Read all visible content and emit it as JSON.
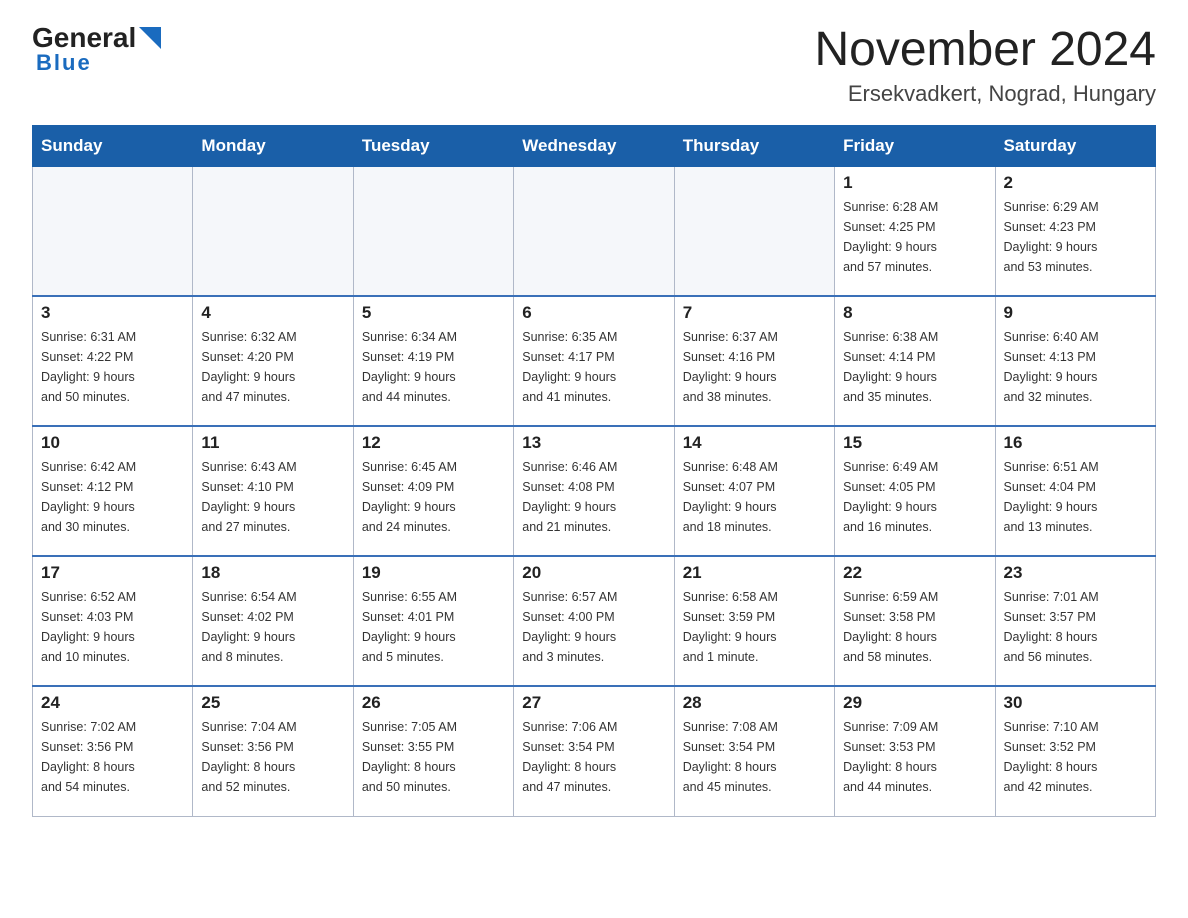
{
  "logo": {
    "name_black": "General",
    "name_blue": "Blue",
    "tagline": "Blue"
  },
  "header": {
    "title": "November 2024",
    "subtitle": "Ersekvadkert, Nograd, Hungary"
  },
  "days_of_week": [
    "Sunday",
    "Monday",
    "Tuesday",
    "Wednesday",
    "Thursday",
    "Friday",
    "Saturday"
  ],
  "weeks": [
    {
      "days": [
        {
          "num": "",
          "info": ""
        },
        {
          "num": "",
          "info": ""
        },
        {
          "num": "",
          "info": ""
        },
        {
          "num": "",
          "info": ""
        },
        {
          "num": "",
          "info": ""
        },
        {
          "num": "1",
          "info": "Sunrise: 6:28 AM\nSunset: 4:25 PM\nDaylight: 9 hours\nand 57 minutes."
        },
        {
          "num": "2",
          "info": "Sunrise: 6:29 AM\nSunset: 4:23 PM\nDaylight: 9 hours\nand 53 minutes."
        }
      ]
    },
    {
      "days": [
        {
          "num": "3",
          "info": "Sunrise: 6:31 AM\nSunset: 4:22 PM\nDaylight: 9 hours\nand 50 minutes."
        },
        {
          "num": "4",
          "info": "Sunrise: 6:32 AM\nSunset: 4:20 PM\nDaylight: 9 hours\nand 47 minutes."
        },
        {
          "num": "5",
          "info": "Sunrise: 6:34 AM\nSunset: 4:19 PM\nDaylight: 9 hours\nand 44 minutes."
        },
        {
          "num": "6",
          "info": "Sunrise: 6:35 AM\nSunset: 4:17 PM\nDaylight: 9 hours\nand 41 minutes."
        },
        {
          "num": "7",
          "info": "Sunrise: 6:37 AM\nSunset: 4:16 PM\nDaylight: 9 hours\nand 38 minutes."
        },
        {
          "num": "8",
          "info": "Sunrise: 6:38 AM\nSunset: 4:14 PM\nDaylight: 9 hours\nand 35 minutes."
        },
        {
          "num": "9",
          "info": "Sunrise: 6:40 AM\nSunset: 4:13 PM\nDaylight: 9 hours\nand 32 minutes."
        }
      ]
    },
    {
      "days": [
        {
          "num": "10",
          "info": "Sunrise: 6:42 AM\nSunset: 4:12 PM\nDaylight: 9 hours\nand 30 minutes."
        },
        {
          "num": "11",
          "info": "Sunrise: 6:43 AM\nSunset: 4:10 PM\nDaylight: 9 hours\nand 27 minutes."
        },
        {
          "num": "12",
          "info": "Sunrise: 6:45 AM\nSunset: 4:09 PM\nDaylight: 9 hours\nand 24 minutes."
        },
        {
          "num": "13",
          "info": "Sunrise: 6:46 AM\nSunset: 4:08 PM\nDaylight: 9 hours\nand 21 minutes."
        },
        {
          "num": "14",
          "info": "Sunrise: 6:48 AM\nSunset: 4:07 PM\nDaylight: 9 hours\nand 18 minutes."
        },
        {
          "num": "15",
          "info": "Sunrise: 6:49 AM\nSunset: 4:05 PM\nDaylight: 9 hours\nand 16 minutes."
        },
        {
          "num": "16",
          "info": "Sunrise: 6:51 AM\nSunset: 4:04 PM\nDaylight: 9 hours\nand 13 minutes."
        }
      ]
    },
    {
      "days": [
        {
          "num": "17",
          "info": "Sunrise: 6:52 AM\nSunset: 4:03 PM\nDaylight: 9 hours\nand 10 minutes."
        },
        {
          "num": "18",
          "info": "Sunrise: 6:54 AM\nSunset: 4:02 PM\nDaylight: 9 hours\nand 8 minutes."
        },
        {
          "num": "19",
          "info": "Sunrise: 6:55 AM\nSunset: 4:01 PM\nDaylight: 9 hours\nand 5 minutes."
        },
        {
          "num": "20",
          "info": "Sunrise: 6:57 AM\nSunset: 4:00 PM\nDaylight: 9 hours\nand 3 minutes."
        },
        {
          "num": "21",
          "info": "Sunrise: 6:58 AM\nSunset: 3:59 PM\nDaylight: 9 hours\nand 1 minute."
        },
        {
          "num": "22",
          "info": "Sunrise: 6:59 AM\nSunset: 3:58 PM\nDaylight: 8 hours\nand 58 minutes."
        },
        {
          "num": "23",
          "info": "Sunrise: 7:01 AM\nSunset: 3:57 PM\nDaylight: 8 hours\nand 56 minutes."
        }
      ]
    },
    {
      "days": [
        {
          "num": "24",
          "info": "Sunrise: 7:02 AM\nSunset: 3:56 PM\nDaylight: 8 hours\nand 54 minutes."
        },
        {
          "num": "25",
          "info": "Sunrise: 7:04 AM\nSunset: 3:56 PM\nDaylight: 8 hours\nand 52 minutes."
        },
        {
          "num": "26",
          "info": "Sunrise: 7:05 AM\nSunset: 3:55 PM\nDaylight: 8 hours\nand 50 minutes."
        },
        {
          "num": "27",
          "info": "Sunrise: 7:06 AM\nSunset: 3:54 PM\nDaylight: 8 hours\nand 47 minutes."
        },
        {
          "num": "28",
          "info": "Sunrise: 7:08 AM\nSunset: 3:54 PM\nDaylight: 8 hours\nand 45 minutes."
        },
        {
          "num": "29",
          "info": "Sunrise: 7:09 AM\nSunset: 3:53 PM\nDaylight: 8 hours\nand 44 minutes."
        },
        {
          "num": "30",
          "info": "Sunrise: 7:10 AM\nSunset: 3:52 PM\nDaylight: 8 hours\nand 42 minutes."
        }
      ]
    }
  ]
}
